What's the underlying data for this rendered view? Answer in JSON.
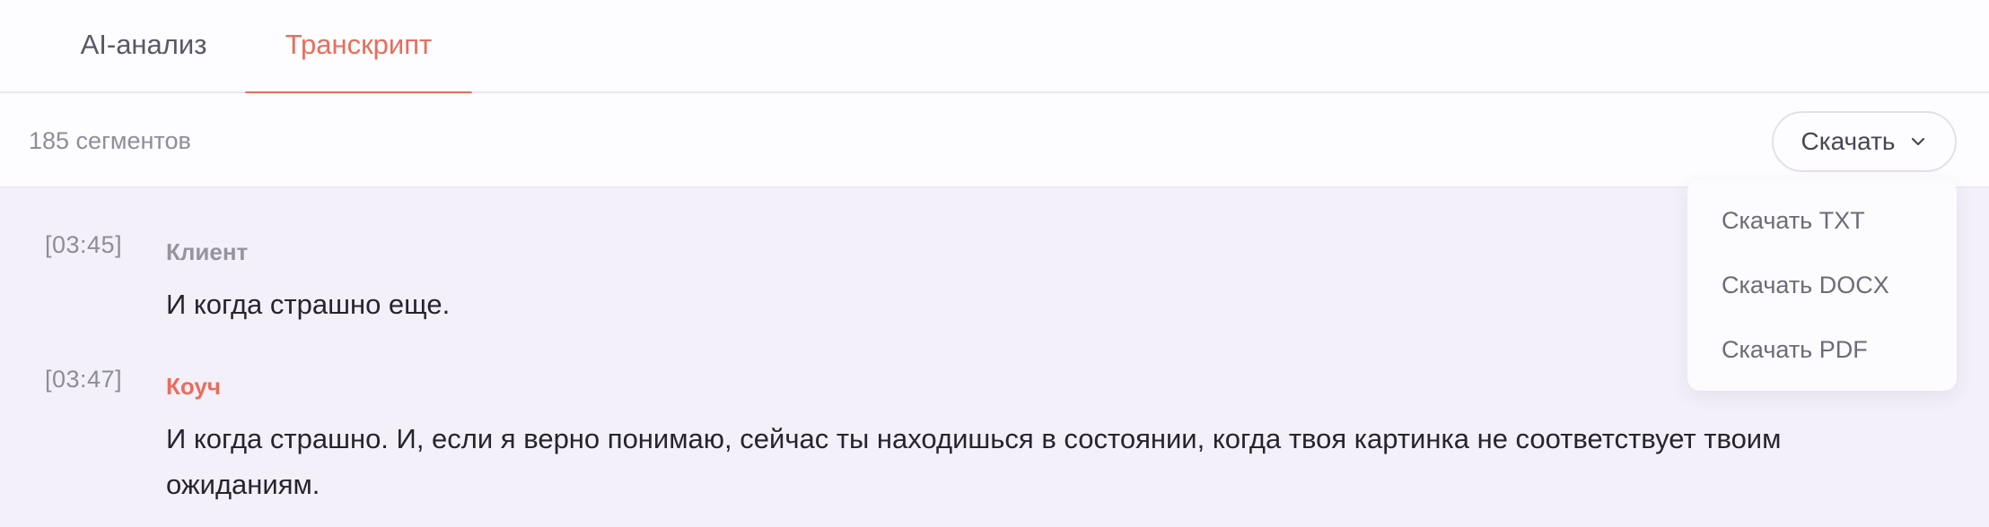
{
  "tabs": [
    {
      "label": "AI-анализ",
      "active": false
    },
    {
      "label": "Транскрипт",
      "active": true
    }
  ],
  "toolbar": {
    "segments_count": "185 сегментов",
    "download_label": "Скачать"
  },
  "dropdown": {
    "items": [
      {
        "label": "Скачать TXT"
      },
      {
        "label": "Скачать DOCX"
      },
      {
        "label": "Скачать PDF"
      }
    ]
  },
  "segments": [
    {
      "timestamp": "[03:45]",
      "speaker": "Клиент",
      "text": "И когда страшно еще."
    },
    {
      "timestamp": "[03:47]",
      "speaker": "Коуч",
      "text": "И когда страшно. И, если я верно понимаю, сейчас ты находишься в состоянии, когда твоя картинка не соответствует твоим ожиданиям."
    }
  ],
  "colors": {
    "accent": "#ea6d5b",
    "background": "#f3f0fa",
    "panel": "#fdfcfe"
  },
  "icons": {
    "download_chevron": "chevron-down-icon"
  }
}
